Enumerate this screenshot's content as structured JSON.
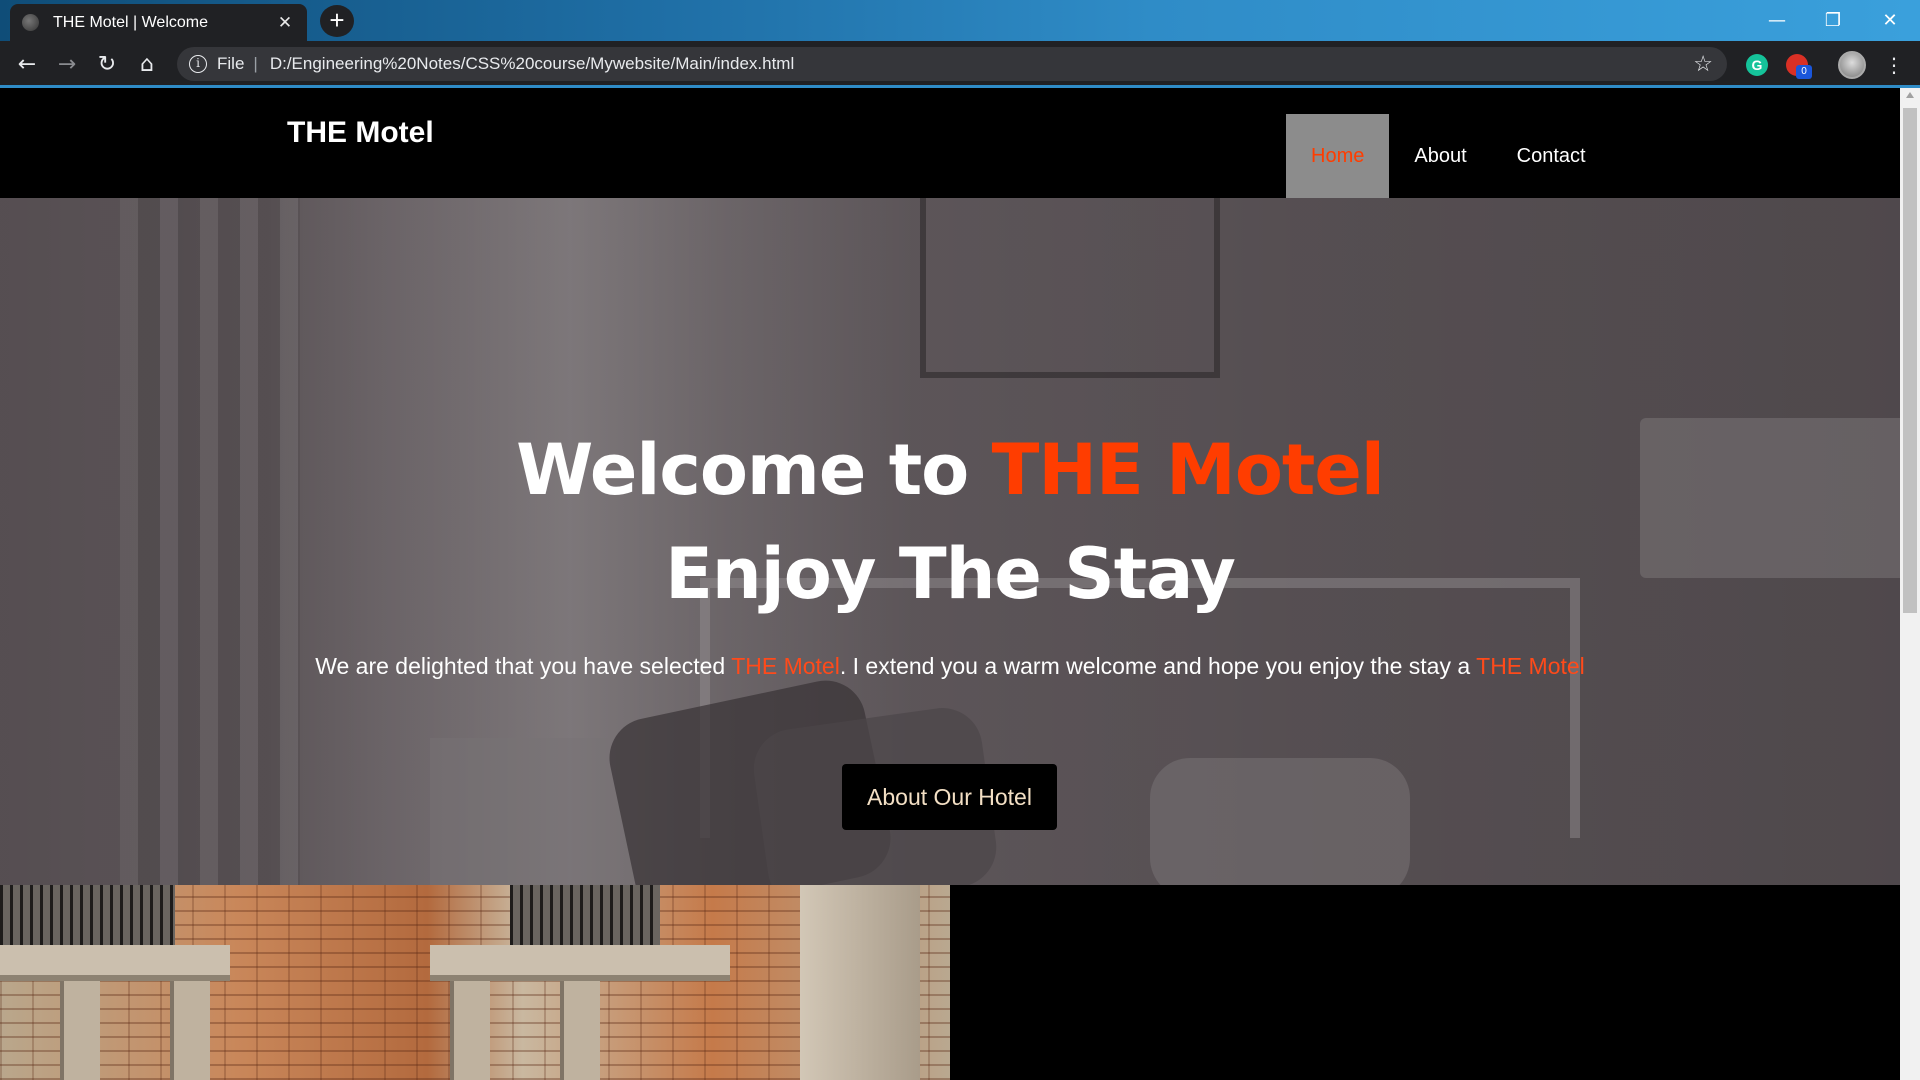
{
  "browser": {
    "tab_title": "THE Motel | Welcome",
    "tab_close": "✕",
    "new_tab": "+",
    "window_controls": {
      "minimize": "—",
      "restore": "❐",
      "close": "✕"
    },
    "nav": {
      "back": "←",
      "forward": "→",
      "reload": "↻",
      "home": "⌂"
    },
    "address": {
      "info": "i",
      "scheme": "File",
      "separator": "|",
      "url": "D:/Engineering%20Notes/CSS%20course/Mywebsite/Main/index.html"
    },
    "bookmark": "☆",
    "extensions": {
      "grammarly": "G",
      "badge_count": "0"
    },
    "menu": "⋮"
  },
  "site": {
    "logo": "THE Motel",
    "nav": [
      {
        "label": "Home",
        "active": true
      },
      {
        "label": "About",
        "active": false
      },
      {
        "label": "Contact",
        "active": false
      }
    ]
  },
  "hero": {
    "title_line1_prefix": "Welcome to ",
    "title_line1_accent": "THE Motel",
    "title_line2": "Enjoy The Stay",
    "subtitle_part1": "We are delighted that you have selected ",
    "subtitle_accent1": "THE Motel",
    "subtitle_part2": ". I extend you a warm welcome and hope you enjoy the stay a ",
    "subtitle_accent2": "THE Motel",
    "button_label": "About Our Hotel"
  },
  "colors": {
    "accent": "#ff3d00",
    "nav_active_bg": "#8c8c8c",
    "header_bg": "#000000",
    "button_text": "#f3dfc4"
  }
}
